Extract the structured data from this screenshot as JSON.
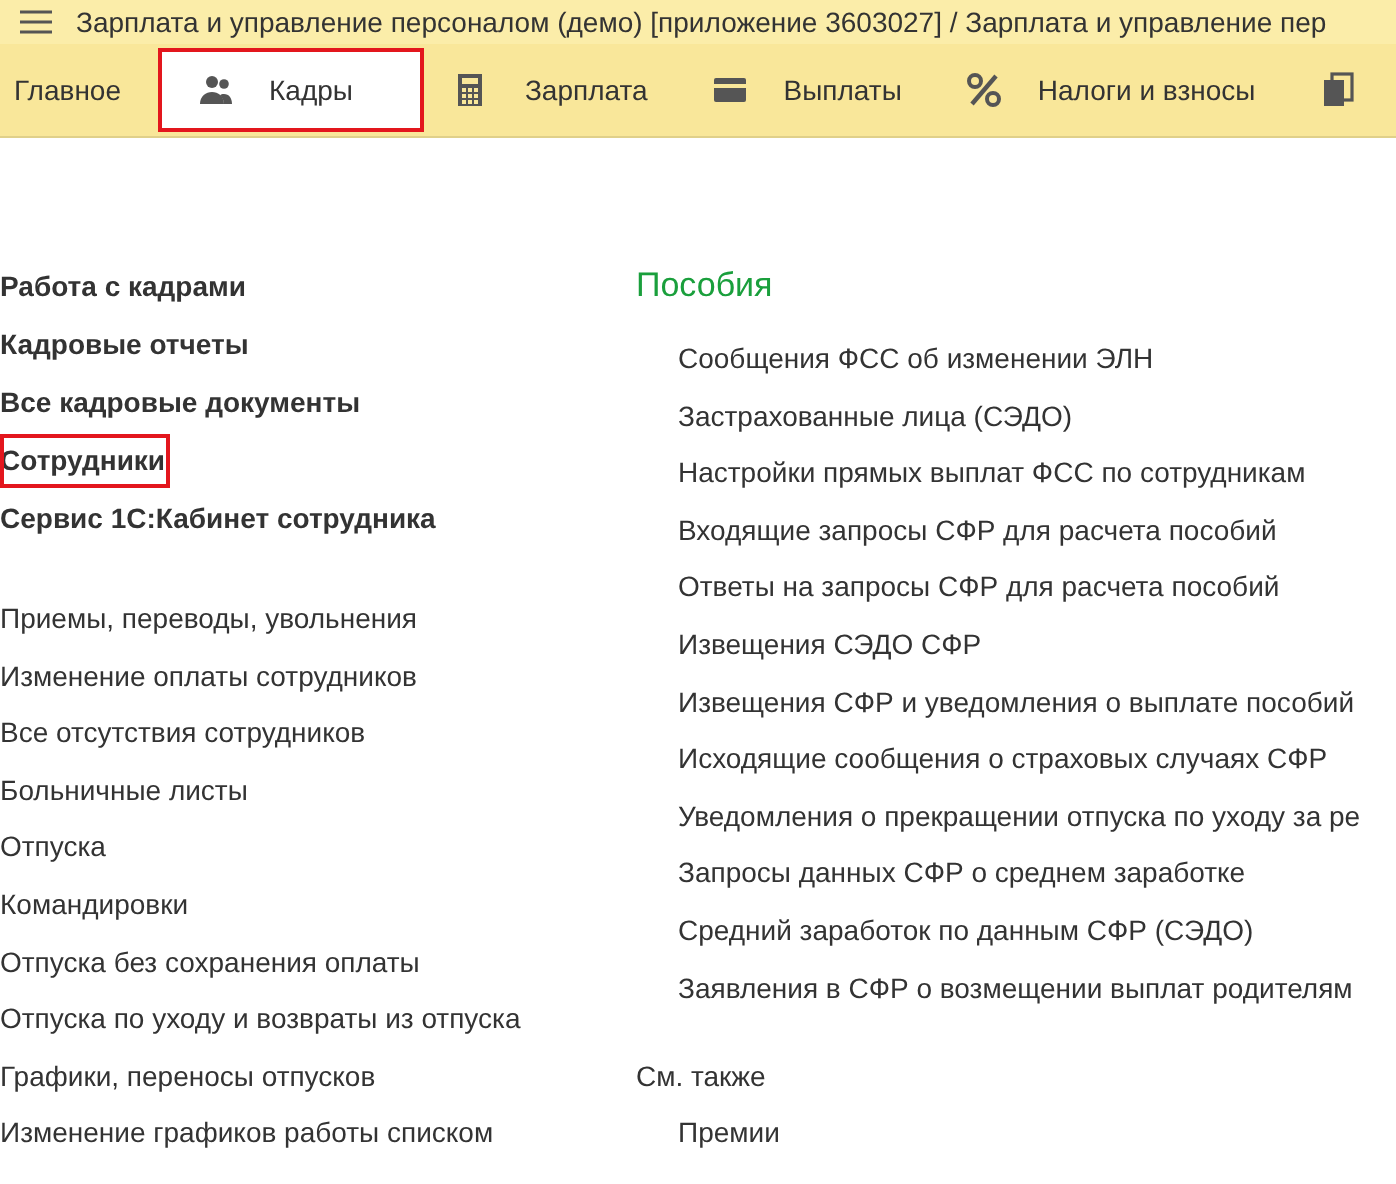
{
  "window": {
    "title": "Зарплата и управление персоналом (демо) [приложение 3603027] / Зарплата и управление пер"
  },
  "sections": [
    {
      "label": "Главное",
      "selected": false,
      "highlighted": false
    },
    {
      "label": "Кадры",
      "selected": true,
      "highlighted": true
    },
    {
      "label": "Зарплата",
      "selected": false,
      "highlighted": false
    },
    {
      "label": "Выплаты",
      "selected": false,
      "highlighted": false
    },
    {
      "label": "Налоги и взносы",
      "selected": false,
      "highlighted": false
    },
    {
      "selected": false,
      "highlighted": false
    }
  ],
  "main_links": [
    {
      "label": "Работа с кадрами",
      "highlighted": false
    },
    {
      "label": "Кадровые отчеты",
      "highlighted": false
    },
    {
      "label": "Все кадровые документы",
      "highlighted": false
    },
    {
      "label": "Сотрудники",
      "highlighted": true
    },
    {
      "label": "Сервис 1С:Кабинет сотрудника",
      "highlighted": false
    }
  ],
  "document_links": [
    "Приемы, переводы, увольнения",
    "Изменение оплаты сотрудников",
    "Все отсутствия сотрудников",
    "Больничные листы",
    "Отпуска",
    "Командировки",
    "Отпуска без сохранения оплаты",
    "Отпуска по уходу и возвраты из отпуска",
    "Графики, переносы отпусков",
    "Изменение графиков работы списком"
  ],
  "benefits": {
    "title": "Пособия",
    "links": [
      "Сообщения ФСС об изменении ЭЛН",
      "Застрахованные лица (СЭДО)",
      "Настройки прямых выплат ФСС по сотрудникам",
      "Входящие запросы СФР для расчета пособий",
      "Ответы на запросы СФР для расчета пособий",
      "Извещения СЭДО СФР",
      "Извещения СФР и уведомления о выплате пособий",
      "Исходящие сообщения о страховых случаях СФР",
      "Уведомления о прекращении отпуска по уходу за ре",
      "Запросы данных СФР о среднем заработке",
      "Средний заработок по данным СФР (СЭДО)",
      "Заявления в СФР о возмещении выплат родителям"
    ]
  },
  "see_also": {
    "title": "См. также",
    "links": [
      "Премии"
    ]
  }
}
